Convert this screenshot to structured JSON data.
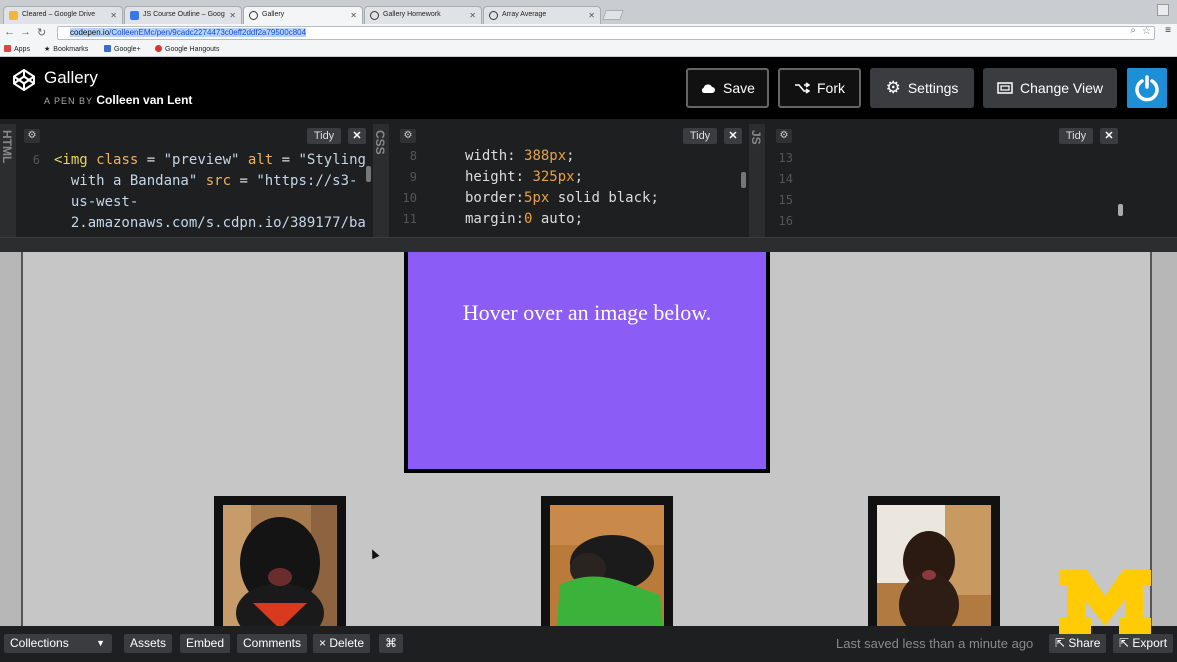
{
  "browser": {
    "tabs": [
      {
        "title": "Cleared – Google Drive",
        "icon": "google-drive-icon",
        "color": "#f1b833"
      },
      {
        "title": "JS Course Outline – Goog",
        "icon": "google-docs-icon",
        "color": "#3b78e7"
      },
      {
        "title": "Gallery",
        "icon": "codepen-icon",
        "color": "#333333",
        "active": true
      },
      {
        "title": "Gallery Homework",
        "icon": "codepen-icon",
        "color": "#333333"
      },
      {
        "title": "Array Average",
        "icon": "codepen-icon",
        "color": "#333333"
      }
    ],
    "url_host": "codepen.io",
    "url_path": "/ColleenEMc/pen/9cadc2274473c0eff2ddf2a79500c804",
    "bookmarks": [
      {
        "label": "Apps",
        "icon": "apps-grid-icon"
      },
      {
        "label": "Bookmarks",
        "icon": "star-icon"
      },
      {
        "label": "Google+",
        "icon": "google-plus-icon"
      },
      {
        "label": "Google Hangouts",
        "icon": "hangouts-icon"
      }
    ]
  },
  "header": {
    "title": "Gallery",
    "by_prefix": "A PEN BY",
    "author": "Colleen van Lent",
    "buttons": {
      "save": "Save",
      "fork": "Fork",
      "settings": "Settings",
      "change_view": "Change View"
    }
  },
  "editors": {
    "html": {
      "label": "HTML",
      "tidy": "Tidy",
      "line_numbers": [
        "6",
        "",
        "",
        ""
      ],
      "code": [
        "<img class = \"preview\" alt = \"Styling",
        "  with a Bandana\" src = \"https://s3-",
        "  us-west-",
        "  2.amazonaws.com/s.cdpn.io/389177/ba"
      ]
    },
    "css": {
      "label": "CSS",
      "tidy": "Tidy",
      "line_numbers": [
        "8",
        "9",
        "10",
        "11"
      ],
      "code": [
        "width: 388px;",
        "height: 325px;",
        "border:5px solid black;",
        "margin:0 auto;"
      ]
    },
    "js": {
      "label": "JS",
      "tidy": "Tidy",
      "line_numbers": [
        "13",
        "14",
        "15",
        "16"
      ]
    }
  },
  "preview": {
    "hover_text": "Hover over an image below.",
    "box_color": "#8b5cf6"
  },
  "footer": {
    "collections": "Collections",
    "assets": "Assets",
    "embed": "Embed",
    "comments": "Comments",
    "delete": "× Delete",
    "shortcut": "⌘",
    "status": "Last saved less than a minute ago",
    "share": "Share",
    "export": "Export"
  },
  "colors": {
    "accent_blue": "#1d8fd6",
    "watermark_maize": "#ffcb05"
  }
}
